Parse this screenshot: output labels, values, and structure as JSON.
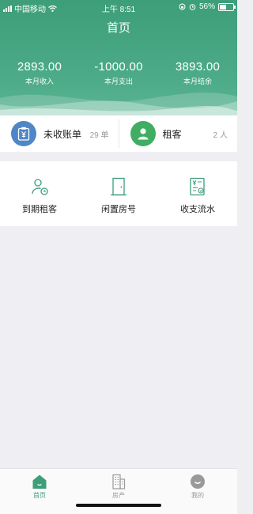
{
  "status_bar": {
    "carrier": "中国移动",
    "time": "上午 8:51",
    "battery_percent": "56%",
    "battery_level": 0.56
  },
  "header": {
    "title": "首页",
    "stats": [
      {
        "value": "2893.00",
        "label": "本月收入"
      },
      {
        "value": "-1000.00",
        "label": "本月支出"
      },
      {
        "value": "3893.00",
        "label": "本月结余"
      }
    ]
  },
  "cards": [
    {
      "label": "未收账单",
      "count": "29 单",
      "icon": "bill-icon",
      "color": "#4f86c6"
    },
    {
      "label": "租客",
      "count": "2 人",
      "icon": "user-icon",
      "color": "#3fae62"
    }
  ],
  "quick_actions": [
    {
      "label": "到期租客",
      "icon": "tenant-clock-icon"
    },
    {
      "label": "闲置房号",
      "icon": "door-icon"
    },
    {
      "label": "收支流水",
      "icon": "ledger-icon"
    }
  ],
  "tabbar": {
    "items": [
      {
        "label": "首页",
        "icon": "home-icon",
        "active": true
      },
      {
        "label": "房产",
        "icon": "building-icon",
        "active": false
      },
      {
        "label": "我的",
        "icon": "profile-icon",
        "active": false
      }
    ]
  },
  "colors": {
    "accent": "#3d9e7a",
    "bill_blue": "#4f86c6",
    "tenant_green": "#3fae62"
  }
}
